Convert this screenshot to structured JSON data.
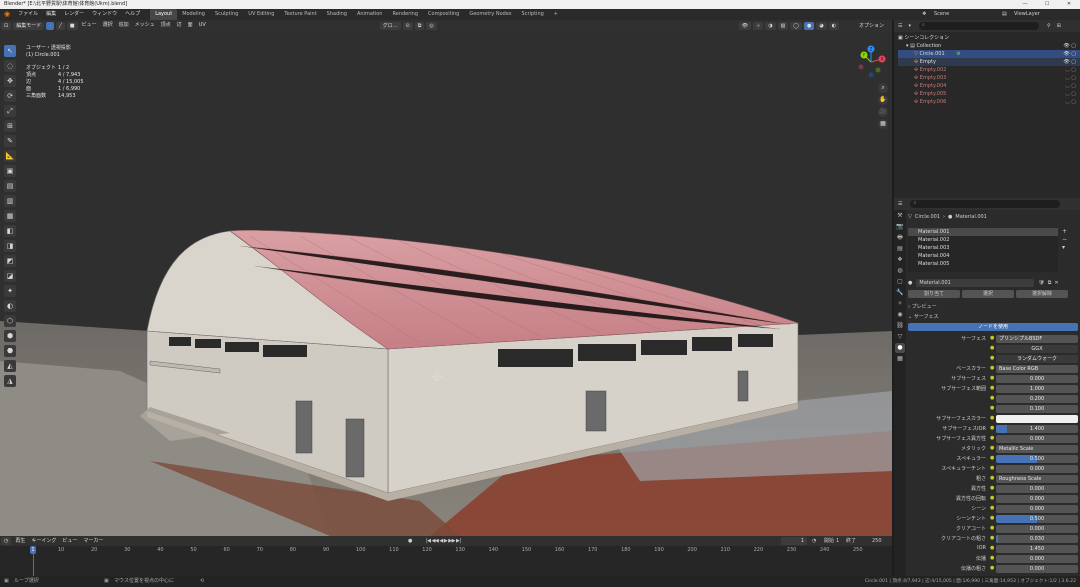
{
  "window": {
    "title": "Blender* [E:\\北平野貨駅\\体育館\\体育館(Ukm).blend]",
    "minimize": "—",
    "maximize": "☐",
    "close": "✕"
  },
  "menu": [
    "ファイル",
    "編集",
    "レンダー",
    "ウィンドウ",
    "ヘルプ"
  ],
  "workspaces": [
    "Layout",
    "Modeling",
    "Sculpting",
    "UV Editing",
    "Texture Paint",
    "Shading",
    "Animation",
    "Rendering",
    "Compositing",
    "Geometry Nodes",
    "Scripting"
  ],
  "workspace_add": "+",
  "scene": {
    "name": "Scene",
    "view_layer": "ViewLayer"
  },
  "viewport_header": {
    "mode": "編集モード",
    "menus": [
      "ビュー",
      "選択",
      "追加",
      "メッシュ",
      "頂点",
      "辺",
      "面",
      "UV"
    ],
    "orientation": "グロ...",
    "options": "オプション"
  },
  "viewport_info": {
    "view": "ユーザー・透視投影",
    "object": "(1) Circle.001"
  },
  "stats": [
    {
      "label": "オブジェクト",
      "value": "1 / 2"
    },
    {
      "label": "頂点",
      "value": "4 / 7,943"
    },
    {
      "label": "辺",
      "value": "4 / 15,005"
    },
    {
      "label": "面",
      "value": "1 / 6,990"
    },
    {
      "label": "三角面数",
      "value": "14,953"
    }
  ],
  "gizmo": {
    "x": "X",
    "y": "Y",
    "z": "Z"
  },
  "tools": [
    "↖",
    "◌",
    "✥",
    "⟳",
    "⤢",
    "⊞",
    "✎",
    "📐",
    "▣",
    "▤",
    "▥",
    "▦",
    "◧",
    "◨",
    "◩",
    "◪",
    "✦",
    "◐",
    "⬡",
    "⬢",
    "⬣",
    "◭",
    "◮"
  ],
  "timeline": {
    "menus": [
      "再生",
      "キーイング",
      "ビュー",
      "マーカー"
    ],
    "current_frame": "1",
    "start_label": "開始",
    "start": "1",
    "end_label": "終了",
    "end": "250",
    "ticks": [
      "1",
      "10",
      "20",
      "30",
      "40",
      "50",
      "60",
      "70",
      "80",
      "90",
      "100",
      "110",
      "120",
      "130",
      "140",
      "150",
      "160",
      "170",
      "180",
      "190",
      "200",
      "210",
      "220",
      "230",
      "240",
      "250"
    ],
    "play_controls": "|◀ ◀◀ ◀ ▶ ▶▶ ▶|"
  },
  "statusbar": {
    "left": "ループ選択",
    "middle": "マウス位置を視点の中心に",
    "right": "Circle.001 | 頂点:4/7,943 | 辺:4/15,005 | 面:1/6,990 | 三角面:14,953 | オブジェクト:1/2 | 3.6.22"
  },
  "outliner": {
    "search_placeholder": "",
    "root": "シーンコレクション",
    "collection": "Collection",
    "items": [
      "Circle.001",
      "Empty",
      "Empty.002",
      "Empty.003",
      "Empty.004",
      "Empty.005",
      "Empty.006"
    ]
  },
  "properties": {
    "breadcrumb_object": "Circle.001",
    "breadcrumb_material": "Material.001",
    "materials": [
      "Material.001",
      "Material.002",
      "Material.003",
      "Material.004",
      "Material.005"
    ],
    "active_material": "Material.001",
    "assign": "割り当て",
    "select": "選択",
    "deselect": "選択解除",
    "preview": "プレビュー",
    "surface_panel": "サーフェス",
    "use_nodes": "ノードを使用",
    "rows": [
      {
        "label": "サーフェス",
        "value": "プリンシプルBSDF",
        "kind": "left"
      },
      {
        "label": "",
        "value": "GGX",
        "kind": "dark"
      },
      {
        "label": "",
        "value": "ランダムウォーク",
        "kind": "dark"
      },
      {
        "label": "ベースカラー",
        "value": "Base Color RGB",
        "kind": "left"
      },
      {
        "label": "サブサーフェス",
        "value": "0.000",
        "kind": "num",
        "fill": 0
      },
      {
        "label": "サブサーフェス範囲",
        "value": "1.000",
        "kind": "num",
        "fill": 0
      },
      {
        "label": "",
        "value": "0.200",
        "kind": "num",
        "fill": 0
      },
      {
        "label": "",
        "value": "0.100",
        "kind": "num",
        "fill": 0
      },
      {
        "label": "サブサーフェスカラー",
        "value": "",
        "kind": "color"
      },
      {
        "label": "サブサーフェスIOR",
        "value": "1.400",
        "kind": "num",
        "fill": 0.14
      },
      {
        "label": "サブサーフェス異方性",
        "value": "0.000",
        "kind": "num",
        "fill": 0
      },
      {
        "label": "メタリック",
        "value": "Metallic Scale",
        "kind": "left"
      },
      {
        "label": "スペキュラー",
        "value": "0.500",
        "kind": "num",
        "fill": 0.5
      },
      {
        "label": "スペキュラーチント",
        "value": "0.000",
        "kind": "num",
        "fill": 0
      },
      {
        "label": "粗さ",
        "value": "Roughness Scale",
        "kind": "left"
      },
      {
        "label": "異方性",
        "value": "0.000",
        "kind": "num",
        "fill": 0
      },
      {
        "label": "異方性の回転",
        "value": "0.000",
        "kind": "num",
        "fill": 0
      },
      {
        "label": "シーン",
        "value": "0.000",
        "kind": "num",
        "fill": 0
      },
      {
        "label": "シーンチント",
        "value": "0.500",
        "kind": "num",
        "fill": 0.5
      },
      {
        "label": "クリアコート",
        "value": "0.000",
        "kind": "num",
        "fill": 0
      },
      {
        "label": "クリアコートの粗さ",
        "value": "0.030",
        "kind": "num",
        "fill": 0.03
      },
      {
        "label": "IOR",
        "value": "1.450",
        "kind": "num",
        "fill": 0
      },
      {
        "label": "伝播",
        "value": "0.000",
        "kind": "num",
        "fill": 0
      },
      {
        "label": "伝播の粗さ",
        "value": "0.000",
        "kind": "num",
        "fill": 0
      }
    ]
  },
  "colors": {
    "accent": "#4772b3",
    "selection": "#334d80",
    "roof": "#c98a8e",
    "wall": "#d8d4cc"
  }
}
